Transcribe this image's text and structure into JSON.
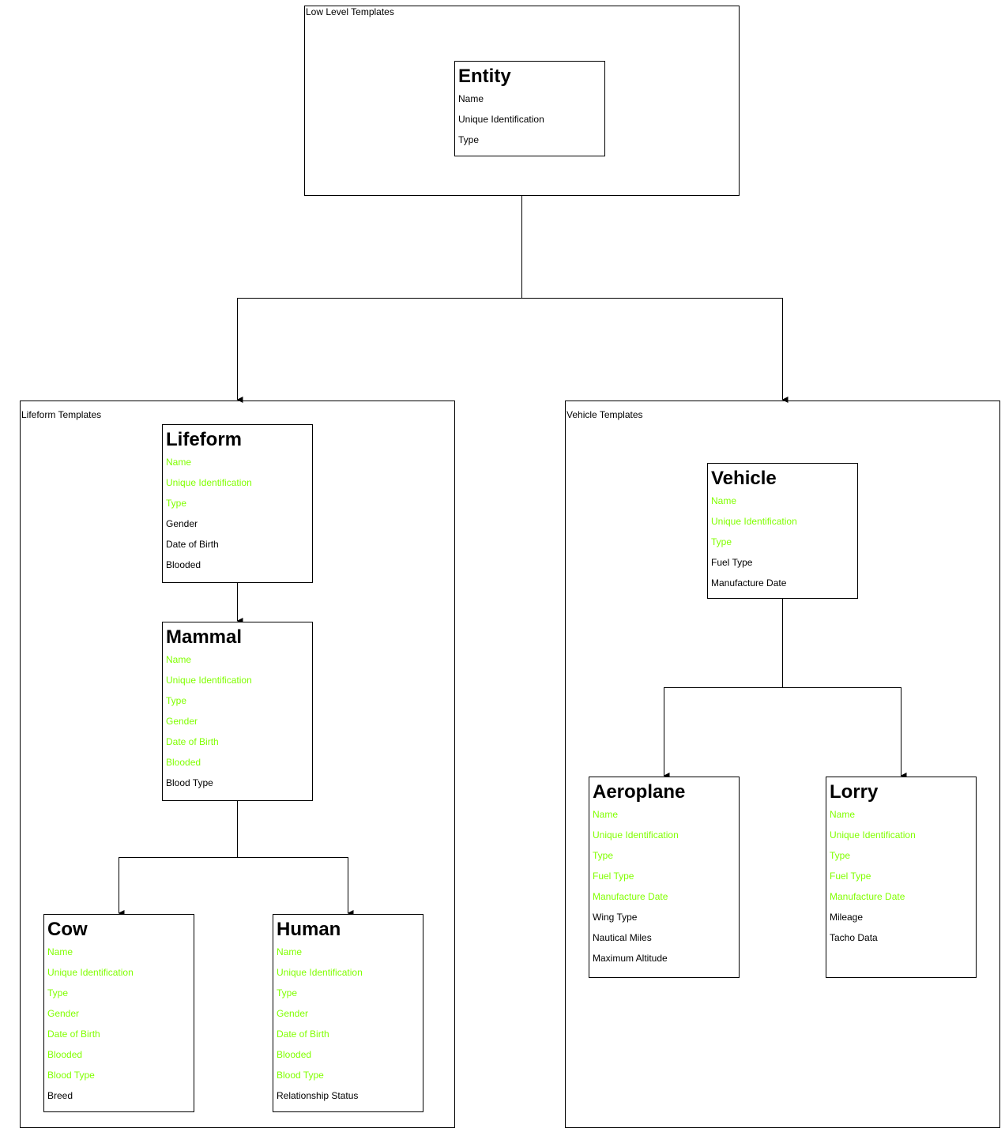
{
  "colors": {
    "inherited": "#80FF00",
    "own": "#000000"
  },
  "groups": {
    "low": {
      "label": "Low Level Templates"
    },
    "lifeform": {
      "label": "Lifeform Templates"
    },
    "vehicle": {
      "label": "Vehicle Templates"
    }
  },
  "cards": {
    "entity": {
      "title": "Entity",
      "fields": [
        {
          "label": "Name",
          "inherited": false
        },
        {
          "label": "Unique Identification",
          "inherited": false
        },
        {
          "label": "Type",
          "inherited": false
        }
      ]
    },
    "lifeform": {
      "title": "Lifeform",
      "fields": [
        {
          "label": "Name",
          "inherited": true
        },
        {
          "label": "Unique Identification",
          "inherited": true
        },
        {
          "label": "Type",
          "inherited": true
        },
        {
          "label": "Gender",
          "inherited": false
        },
        {
          "label": "Date of Birth",
          "inherited": false
        },
        {
          "label": "Blooded",
          "inherited": false
        }
      ]
    },
    "mammal": {
      "title": "Mammal",
      "fields": [
        {
          "label": "Name",
          "inherited": true
        },
        {
          "label": "Unique Identification",
          "inherited": true
        },
        {
          "label": "Type",
          "inherited": true
        },
        {
          "label": "Gender",
          "inherited": true
        },
        {
          "label": "Date of Birth",
          "inherited": true
        },
        {
          "label": "Blooded",
          "inherited": true
        },
        {
          "label": "Blood Type",
          "inherited": false
        }
      ]
    },
    "cow": {
      "title": "Cow",
      "fields": [
        {
          "label": "Name",
          "inherited": true
        },
        {
          "label": "Unique Identification",
          "inherited": true
        },
        {
          "label": "Type",
          "inherited": true
        },
        {
          "label": "Gender",
          "inherited": true
        },
        {
          "label": "Date of Birth",
          "inherited": true
        },
        {
          "label": "Blooded",
          "inherited": true
        },
        {
          "label": "Blood Type",
          "inherited": true
        },
        {
          "label": "Breed",
          "inherited": false
        }
      ]
    },
    "human": {
      "title": "Human",
      "fields": [
        {
          "label": "Name",
          "inherited": true
        },
        {
          "label": "Unique Identification",
          "inherited": true
        },
        {
          "label": "Type",
          "inherited": true
        },
        {
          "label": "Gender",
          "inherited": true
        },
        {
          "label": "Date of Birth",
          "inherited": true
        },
        {
          "label": "Blooded",
          "inherited": true
        },
        {
          "label": "Blood Type",
          "inherited": true
        },
        {
          "label": "Relationship Status",
          "inherited": false
        }
      ]
    },
    "vehicle": {
      "title": "Vehicle",
      "fields": [
        {
          "label": "Name",
          "inherited": true
        },
        {
          "label": "Unique Identification",
          "inherited": true
        },
        {
          "label": "Type",
          "inherited": true
        },
        {
          "label": "Fuel Type",
          "inherited": false
        },
        {
          "label": "Manufacture Date",
          "inherited": false
        }
      ]
    },
    "aeroplane": {
      "title": "Aeroplane",
      "fields": [
        {
          "label": "Name",
          "inherited": true
        },
        {
          "label": "Unique Identification",
          "inherited": true
        },
        {
          "label": "Type",
          "inherited": true
        },
        {
          "label": "Fuel Type",
          "inherited": true
        },
        {
          "label": "Manufacture Date",
          "inherited": true
        },
        {
          "label": "Wing Type",
          "inherited": false
        },
        {
          "label": "Nautical Miles",
          "inherited": false
        },
        {
          "label": "Maximum Altitude",
          "inherited": false
        }
      ]
    },
    "lorry": {
      "title": "Lorry",
      "fields": [
        {
          "label": "Name",
          "inherited": true
        },
        {
          "label": "Unique Identification",
          "inherited": true
        },
        {
          "label": "Type",
          "inherited": true
        },
        {
          "label": "Fuel Type",
          "inherited": true
        },
        {
          "label": "Manufacture Date",
          "inherited": true
        },
        {
          "label": "Mileage",
          "inherited": false
        },
        {
          "label": "Tacho Data",
          "inherited": false
        }
      ]
    }
  }
}
